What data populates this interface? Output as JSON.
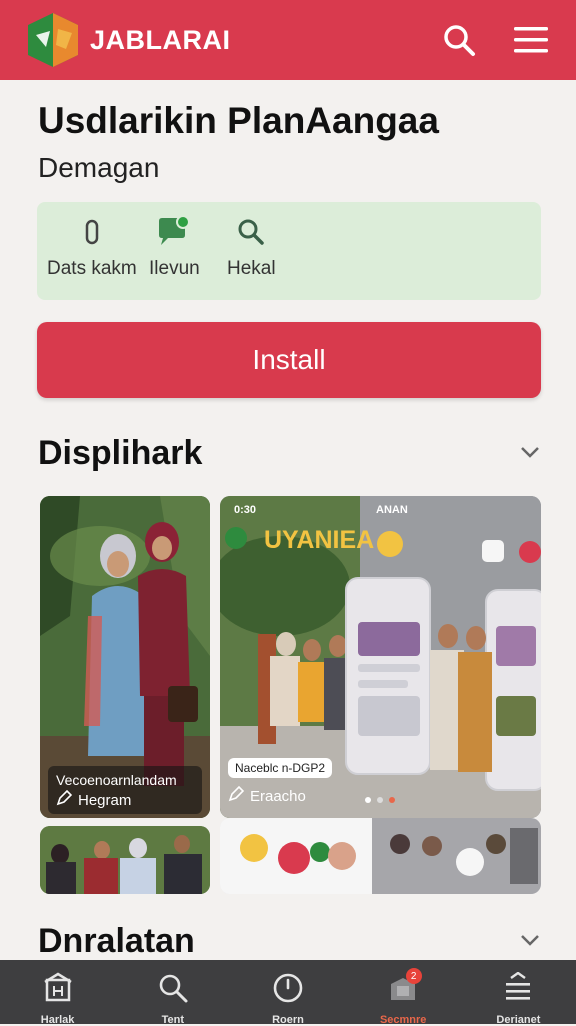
{
  "header": {
    "brand": "JABLARAI",
    "icons": [
      "app-logo-icon",
      "search-icon",
      "menu-icon"
    ]
  },
  "app": {
    "title": "Usdlarikin PlanAangaa",
    "subtitle": "Demagan"
  },
  "info_items": [
    {
      "icon": "lock-icon",
      "label": "Dats kakm"
    },
    {
      "icon": "chat-icon",
      "label": "Ilevun"
    },
    {
      "icon": "search-icon",
      "label": "Hekal"
    }
  ],
  "install_label": "Install",
  "sections": {
    "first": "Displihark",
    "second": "Dnralatan"
  },
  "screenshots": {
    "card1_caption_top": "Vecoenoarnlandam",
    "card1_caption_bottom": "Hegram",
    "card2_header": "UYANIEA",
    "card2_status": "ANAN",
    "card2_time": "0:30",
    "card2_pill": "Naceblc n-DGP2",
    "card2_caption": "Eraacho"
  },
  "bottom_nav": [
    {
      "icon": "home-icon",
      "label": "Harlak"
    },
    {
      "icon": "search-icon",
      "label": "Tent"
    },
    {
      "icon": "clock-icon",
      "label": "Roern"
    },
    {
      "icon": "bag-icon",
      "label": "Secmnre",
      "badge": "2",
      "active": true
    },
    {
      "icon": "list-icon",
      "label": "Derianet"
    }
  ],
  "colors": {
    "accent": "#d93a4e",
    "info_bg": "#dcedd9",
    "nav_bg": "#3e3e40",
    "nav_active": "#e8674a"
  }
}
